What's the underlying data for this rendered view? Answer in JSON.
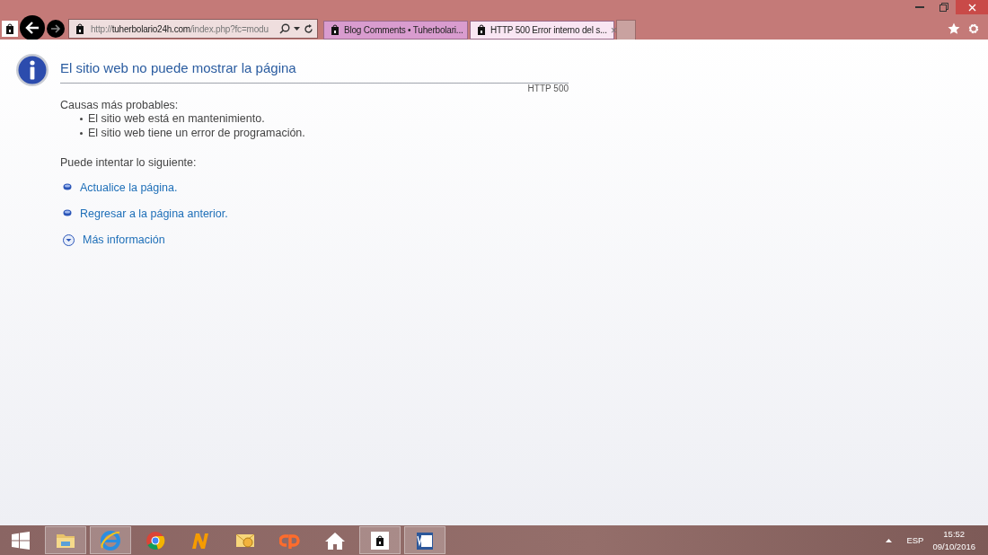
{
  "browser": {
    "address": "http://**tuherbolario24h.com**/index.php?fc=modu",
    "tabs": [
      {
        "title": "Blog Comments • Tuherbolari...",
        "selected": false
      },
      {
        "title": "HTTP 500 Error interno del s...",
        "selected": true,
        "close": "×"
      }
    ]
  },
  "page": {
    "title": "El sitio web no puede mostrar la página",
    "code": "HTTP 500",
    "causes_heading": "Causas más probables:",
    "causes": [
      "El sitio web está en mantenimiento.",
      "El sitio web tiene un error de programación."
    ],
    "try_heading": "Puede intentar lo siguiente:",
    "actions": [
      {
        "kind": "bullet",
        "label": "Actualice la página."
      },
      {
        "kind": "bullet",
        "label": "Regresar a la página anterior."
      },
      {
        "kind": "expand",
        "label": "Más información"
      }
    ]
  },
  "taskbar": {
    "apps": [
      {
        "kind": "folder",
        "running": true
      },
      {
        "kind": "ie",
        "running": true
      },
      {
        "kind": "chrome",
        "running": false
      },
      {
        "kind": "n",
        "running": false
      },
      {
        "kind": "mail",
        "running": false
      },
      {
        "kind": "cp",
        "running": false
      },
      {
        "kind": "home",
        "running": false
      },
      {
        "kind": "site",
        "running": true
      },
      {
        "kind": "word",
        "running": true
      }
    ],
    "language": "ESP",
    "time": "15:52",
    "date": "09/10/2016"
  }
}
